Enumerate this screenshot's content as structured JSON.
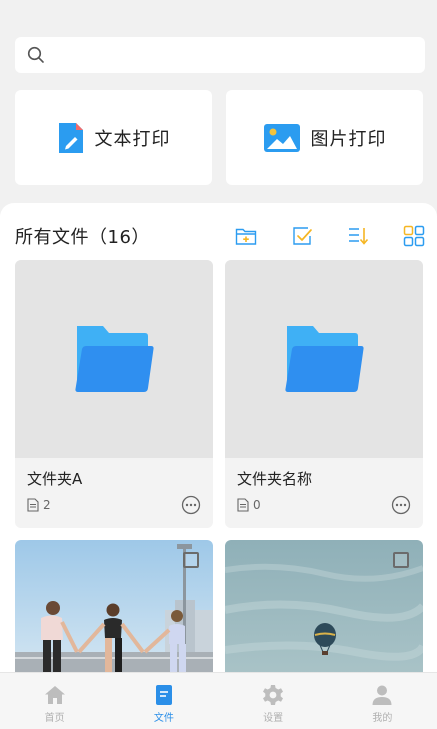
{
  "search": {
    "placeholder": ""
  },
  "actions": [
    {
      "label": "文本打印",
      "icon": "document-edit-icon"
    },
    {
      "label": "图片打印",
      "icon": "image-icon"
    }
  ],
  "files": {
    "title": "所有文件（16）",
    "toolbar": [
      "new-folder-icon",
      "multi-select-icon",
      "sort-icon",
      "grid-view-icon"
    ],
    "folders": [
      {
        "name": "文件夹A",
        "count": "2"
      },
      {
        "name": "文件夹名称",
        "count": "0"
      }
    ],
    "photos": [
      {
        "subject": "three-women-holding-hands"
      },
      {
        "subject": "hot-air-balloon-over-sea"
      }
    ]
  },
  "tabbar": {
    "active": "文件",
    "items": [
      {
        "label": "首页",
        "icon": "home-icon"
      },
      {
        "label": "文件",
        "icon": "file-icon"
      },
      {
        "label": "设置",
        "icon": "gear-icon"
      },
      {
        "label": "我的",
        "icon": "user-icon"
      }
    ]
  },
  "colors": {
    "accent": "#2b8fe8",
    "folder": "#2f8ff0",
    "toolbar_yellow": "#f5b623",
    "background": "#f1f1f1"
  }
}
